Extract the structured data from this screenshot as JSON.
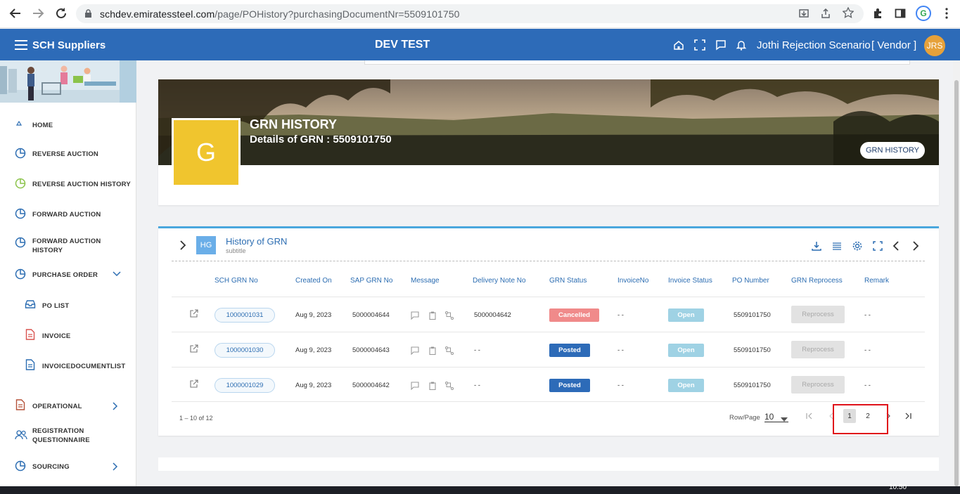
{
  "browser": {
    "url_host": "schdev.emiratessteel.com",
    "url_path": "/page/POHistory?purchasingDocumentNr=5509101750"
  },
  "header": {
    "brand": "SCH Suppliers",
    "environment": "DEV TEST",
    "user_name": "Jothi Rejection Scenario",
    "user_role": "[ Vendor ]",
    "avatar_initials": "JRS"
  },
  "sidebar": {
    "items": [
      {
        "label": "HOME"
      },
      {
        "label": "REVERSE AUCTION"
      },
      {
        "label": "REVERSE AUCTION HISTORY"
      },
      {
        "label": "FORWARD AUCTION"
      },
      {
        "label": "FORWARD AUCTION HISTORY"
      },
      {
        "label": "PURCHASE ORDER"
      },
      {
        "label": "PO LIST"
      },
      {
        "label": "INVOICE"
      },
      {
        "label": "INVOICEDOCUMENTLIST"
      },
      {
        "label": "OPERATIONAL"
      },
      {
        "label": "REGISTRATION QUESTIONNAIRE"
      },
      {
        "label": "SOURCING"
      }
    ]
  },
  "banner": {
    "avatar_letter": "G",
    "title": "GRN HISTORY",
    "details": "Details of GRN : 5509101750",
    "pill": "GRN HISTORY"
  },
  "table_card": {
    "badge": "HG",
    "title": "History of GRN",
    "subtitle": "subtitle",
    "columns": [
      "SCH GRN No",
      "Created On",
      "SAP GRN No",
      "Message",
      "Delivery Note No",
      "GRN Status",
      "InvoiceNo",
      "Invoice Status",
      "PO Number",
      "GRN Reprocess",
      "Remark"
    ],
    "rows": [
      {
        "sch_grn": "1000001031",
        "created": "Aug 9, 2023",
        "sap_grn": "5000004644",
        "delivery_note": "5000004642",
        "grn_status": "Cancelled",
        "invoice_no": "- -",
        "invoice_status": "Open",
        "po_number": "5509101750",
        "reprocess": "Reprocess",
        "remark": "- -"
      },
      {
        "sch_grn": "1000001030",
        "created": "Aug 9, 2023",
        "sap_grn": "5000004643",
        "delivery_note": "- -",
        "grn_status": "Posted",
        "invoice_no": "- -",
        "invoice_status": "Open",
        "po_number": "5509101750",
        "reprocess": "Reprocess",
        "remark": "- -"
      },
      {
        "sch_grn": "1000001029",
        "created": "Aug 9, 2023",
        "sap_grn": "5000004642",
        "delivery_note": "- -",
        "grn_status": "Posted",
        "invoice_no": "- -",
        "invoice_status": "Open",
        "po_number": "5509101750",
        "reprocess": "Reprocess",
        "remark": "- -"
      }
    ],
    "range": "1 – 10 of 12",
    "rows_per_page_label": "Row/Page",
    "rows_per_page": "10",
    "pages": [
      "1",
      "2"
    ]
  },
  "taskbar": {
    "clock": "10:50"
  },
  "colors": {
    "header": "#2d6bb8",
    "cancelled": "#f08a8a",
    "posted": "#2d6bb8",
    "open": "#9fd2e4",
    "avatar": "#f0c52e",
    "highlight": "#e0121a"
  }
}
